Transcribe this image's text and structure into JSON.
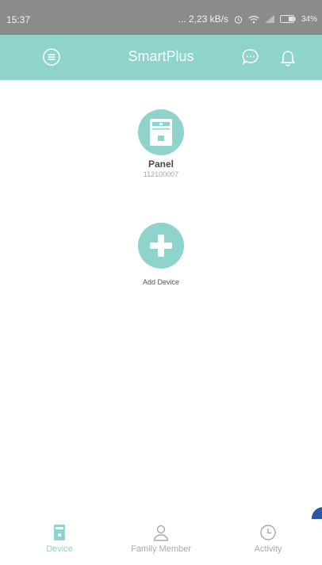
{
  "status_bar": {
    "time": "15:37",
    "network_speed": "... 2,23 kB/s",
    "battery": "34%"
  },
  "header": {
    "title": "SmartPlus",
    "menu_icon": "menu-icon",
    "message_icon": "chat-bubble-icon",
    "notification_icon": "bell-icon"
  },
  "devices": [
    {
      "name": "Panel",
      "id": "112100007",
      "icon": "door-panel-icon"
    }
  ],
  "add_device": {
    "label": "Add Device",
    "icon": "plus-icon"
  },
  "nav": {
    "items": [
      {
        "label": "Device",
        "icon": "device-icon",
        "active": true
      },
      {
        "label": "Family Member",
        "icon": "person-icon",
        "active": false
      },
      {
        "label": "Activity",
        "icon": "clock-icon",
        "active": false
      }
    ]
  },
  "colors": {
    "accent": "#8ed3cc",
    "status_bar": "#8b8b8b",
    "floating_dot": "#2a57a6"
  }
}
